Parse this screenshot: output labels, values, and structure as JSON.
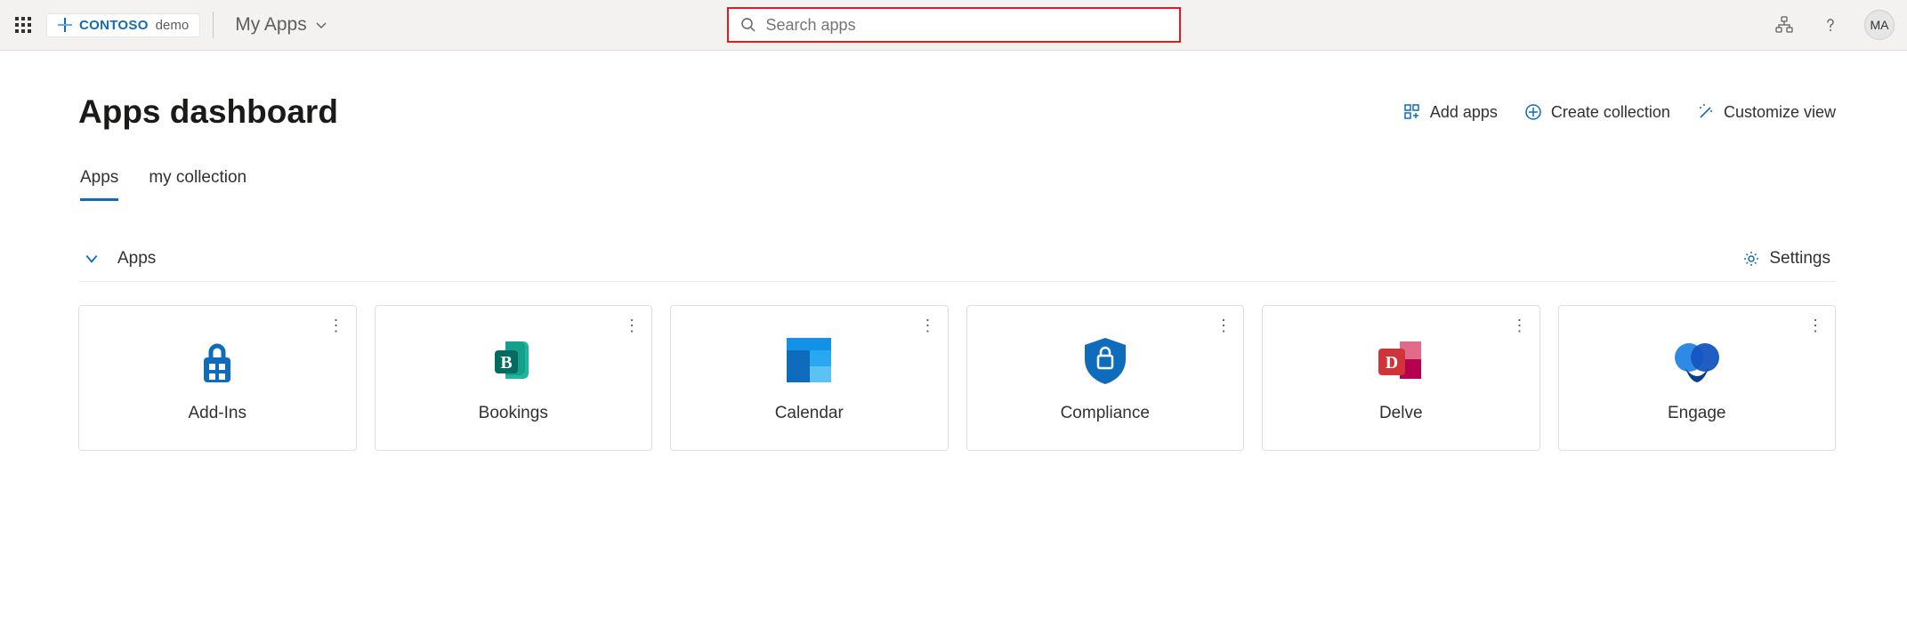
{
  "header": {
    "brand_name": "CONTOSO",
    "brand_suffix": "demo",
    "nav_label": "My Apps",
    "search_placeholder": "Search apps",
    "avatar_initials": "MA"
  },
  "page": {
    "title": "Apps dashboard"
  },
  "commands": {
    "add_apps": "Add apps",
    "create_collection": "Create collection",
    "customize_view": "Customize view"
  },
  "tabs": [
    {
      "label": "Apps",
      "active": true
    },
    {
      "label": "my collection",
      "active": false
    }
  ],
  "section": {
    "title": "Apps",
    "settings_label": "Settings"
  },
  "apps": [
    {
      "name": "Add-Ins",
      "icon": "addins"
    },
    {
      "name": "Bookings",
      "icon": "bookings"
    },
    {
      "name": "Calendar",
      "icon": "calendar"
    },
    {
      "name": "Compliance",
      "icon": "compliance"
    },
    {
      "name": "Delve",
      "icon": "delve"
    },
    {
      "name": "Engage",
      "icon": "engage"
    }
  ]
}
